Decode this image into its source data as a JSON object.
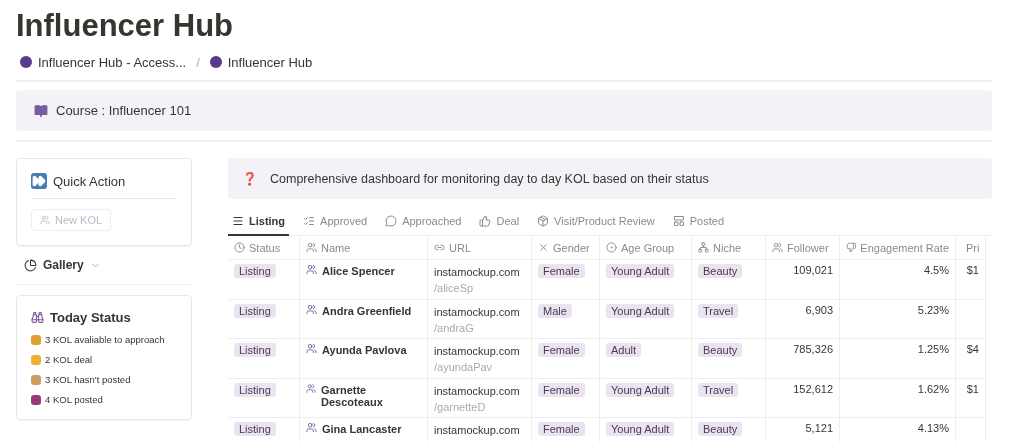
{
  "title": "Influencer Hub",
  "breadcrumb": [
    "Influencer Hub - Access...",
    "Influencer Hub"
  ],
  "breadcrumb_separator": "/",
  "course_callout": "Course : Influencer 101",
  "quick_action": {
    "title": "Quick Action",
    "button": {
      "label": "New KOL",
      "disabled": true
    }
  },
  "gallery": {
    "label": "Gallery"
  },
  "today_status": {
    "title": "Today Status",
    "items": [
      "3 KOL avaliable to approach",
      "2 KOL deal",
      "3 KOL hasn't posted",
      "4 KOL posted"
    ]
  },
  "info_callout": {
    "icon": "❓",
    "text": "Comprehensive dashboard for monitoring day to day KOL based on their status"
  },
  "tabs": [
    {
      "label": "Listing",
      "selected": true
    },
    {
      "label": "Approved",
      "selected": false
    },
    {
      "label": "Approached",
      "selected": false
    },
    {
      "label": "Deal",
      "selected": false
    },
    {
      "label": "Visit/Product Review",
      "selected": false
    },
    {
      "label": "Posted",
      "selected": false
    }
  ],
  "table": {
    "columns": [
      "Status",
      "Name",
      "URL",
      "Gender",
      "Age Group",
      "Niche",
      "Follower",
      "Engagement Rate",
      "Pri"
    ],
    "rows": [
      {
        "status": "Listing",
        "name": "Alice Spencer",
        "url": "instamockup.com",
        "url_path": "/aliceSp",
        "gender": "Female",
        "age_group": "Young Adult",
        "niche": "Beauty",
        "follower": "109,021",
        "engagement_rate": "4.5%",
        "price": "$1"
      },
      {
        "status": "Listing",
        "name": "Andra Greenfield",
        "url": "instamockup.com",
        "url_path": "/andraG",
        "gender": "Male",
        "age_group": "Young Adult",
        "niche": "Travel",
        "follower": "6,903",
        "engagement_rate": "5.23%"
      },
      {
        "status": "Listing",
        "name": "Ayunda Pavlova",
        "url": "instamockup.com",
        "url_path": "/ayundaPav",
        "gender": "Female",
        "age_group": "Adult",
        "niche": "Beauty",
        "follower": "785,326",
        "engagement_rate": "1.25%",
        "price": "$4"
      },
      {
        "status": "Listing",
        "name": "Garnette Descoteaux",
        "url": "instamockup.com",
        "url_path": "/garnetteD",
        "gender": "Female",
        "age_group": "Young Adult",
        "niche": "Travel",
        "follower": "152,612",
        "engagement_rate": "1.62%",
        "price": "$1"
      },
      {
        "status": "Listing",
        "name": "Gina Lancaster",
        "url": "instamockup.com",
        "gender": "Female",
        "age_group": "Young Adult",
        "niche": "Beauty",
        "follower": "5,121",
        "engagement_rate": "4.13%"
      }
    ]
  }
}
